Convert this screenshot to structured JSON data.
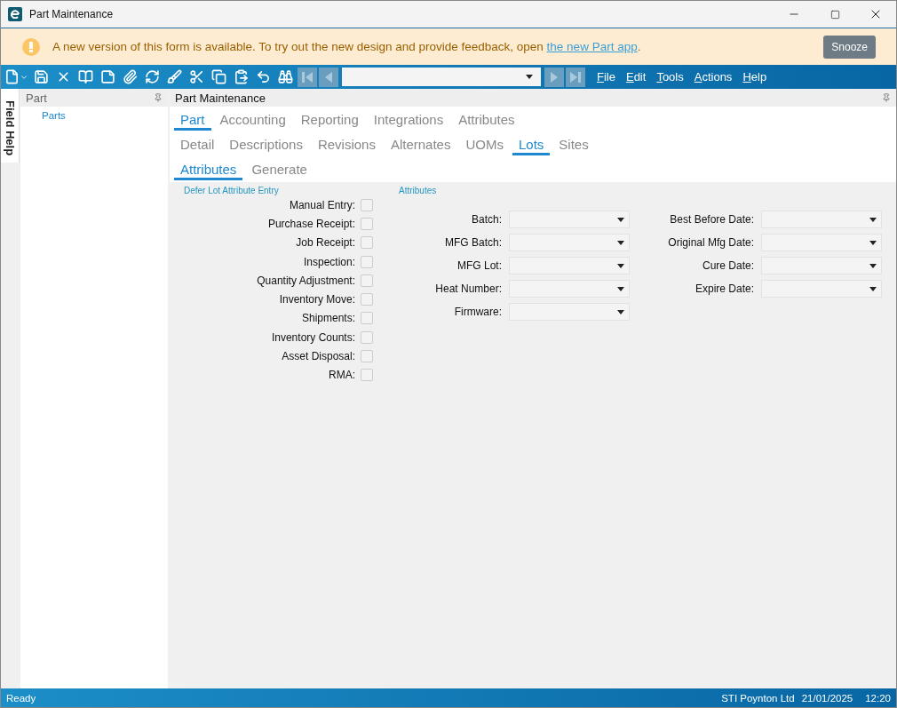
{
  "window": {
    "title": "Part Maintenance"
  },
  "banner": {
    "message": "A new version of this form is available. To try out the new design and provide feedback, open ",
    "link": "the new Part app",
    "after_link": ".",
    "button": "Snooze"
  },
  "menus": [
    "File",
    "Edit",
    "Tools",
    "Actions",
    "Help"
  ],
  "side_tab": "Field Help",
  "tree": {
    "title": "Part",
    "items": [
      {
        "label": "Parts",
        "selected": false
      }
    ]
  },
  "content": {
    "title": "Part Maintenance",
    "tab_rows": [
      [
        {
          "label": "Part",
          "selected": true
        },
        {
          "label": "Accounting",
          "selected": false
        },
        {
          "label": "Reporting",
          "selected": false
        },
        {
          "label": "Integrations",
          "selected": false
        },
        {
          "label": "Attributes",
          "selected": false
        }
      ],
      [
        {
          "label": "Detail",
          "selected": false
        },
        {
          "label": "Descriptions",
          "selected": false
        },
        {
          "label": "Revisions",
          "selected": false
        },
        {
          "label": "Alternates",
          "selected": false
        },
        {
          "label": "UOMs",
          "selected": false
        },
        {
          "label": "Lots",
          "selected": true
        },
        {
          "label": "Sites",
          "selected": false
        }
      ],
      [
        {
          "label": "Attributes",
          "selected": true
        },
        {
          "label": "Generate",
          "selected": false
        }
      ]
    ],
    "defer": {
      "title": "Defer Lot Attribute Entry",
      "items": [
        {
          "label": "Manual Entry:",
          "checked": false
        },
        {
          "label": "Purchase Receipt:",
          "checked": false
        },
        {
          "label": "Job Receipt:",
          "checked": false
        },
        {
          "label": "Inspection:",
          "checked": false
        },
        {
          "label": "Quantity Adjustment:",
          "checked": false
        },
        {
          "label": "Inventory Move:",
          "checked": false
        },
        {
          "label": "Shipments:",
          "checked": false
        },
        {
          "label": "Inventory Counts:",
          "checked": false
        },
        {
          "label": "Asset Disposal:",
          "checked": false
        },
        {
          "label": "RMA:",
          "checked": false
        }
      ]
    },
    "attributes": {
      "title": "Attributes",
      "columns": [
        [
          {
            "label": "Batch:"
          },
          {
            "label": "MFG Batch:"
          },
          {
            "label": "MFG Lot:"
          },
          {
            "label": "Heat Number:"
          },
          {
            "label": "Firmware:"
          }
        ],
        [
          {
            "label": "Best Before Date:"
          },
          {
            "label": "Original Mfg Date:"
          },
          {
            "label": "Cure Date:"
          },
          {
            "label": "Expire Date:"
          }
        ]
      ]
    }
  },
  "status_bar": {
    "state": "Ready",
    "company": "STI Poynton Ltd",
    "date": "21/01/2025",
    "time": "12:20"
  }
}
